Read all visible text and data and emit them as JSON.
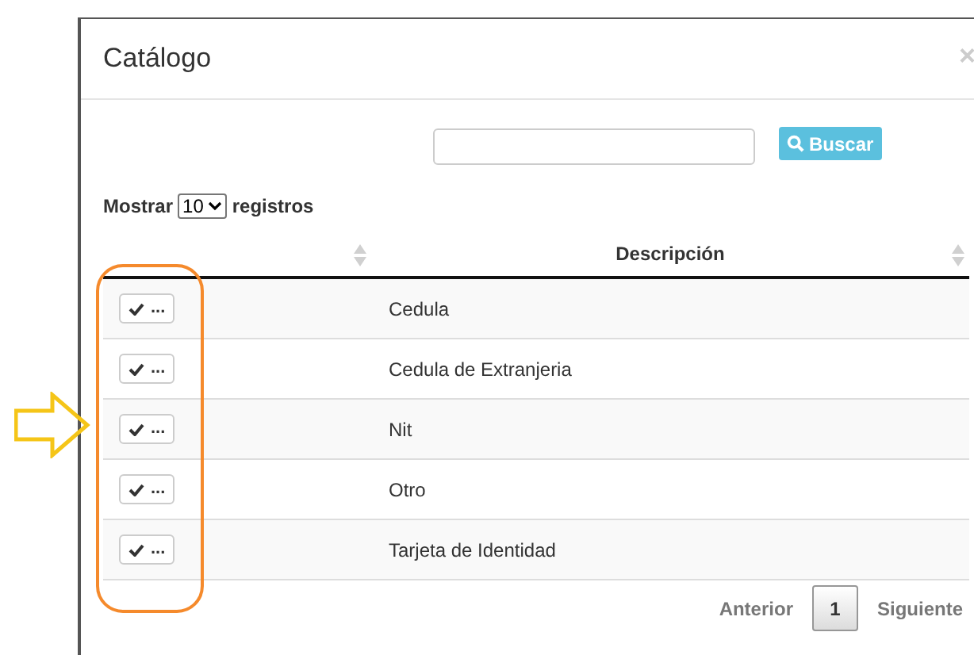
{
  "modal": {
    "title": "Catálogo",
    "close": "×"
  },
  "search": {
    "button": "Buscar"
  },
  "length": {
    "before": "Mostrar",
    "value": "10",
    "after": "registros"
  },
  "table": {
    "columns": [
      {
        "sortable": true
      },
      {
        "label": "Descripción",
        "sortable": true
      }
    ],
    "rows": [
      {
        "action": "...",
        "description": "Cedula"
      },
      {
        "action": "...",
        "description": "Cedula de Extranjeria"
      },
      {
        "action": "...",
        "description": "Nit"
      },
      {
        "action": "...",
        "description": "Otro"
      },
      {
        "action": "...",
        "description": "Tarjeta de Identidad"
      }
    ]
  },
  "pagination": {
    "previous": {
      "label": "Anterior",
      "disabled": true
    },
    "pages": [
      {
        "label": "1",
        "selected": true
      }
    ],
    "next": {
      "label": "Siguiente",
      "disabled": true
    }
  }
}
